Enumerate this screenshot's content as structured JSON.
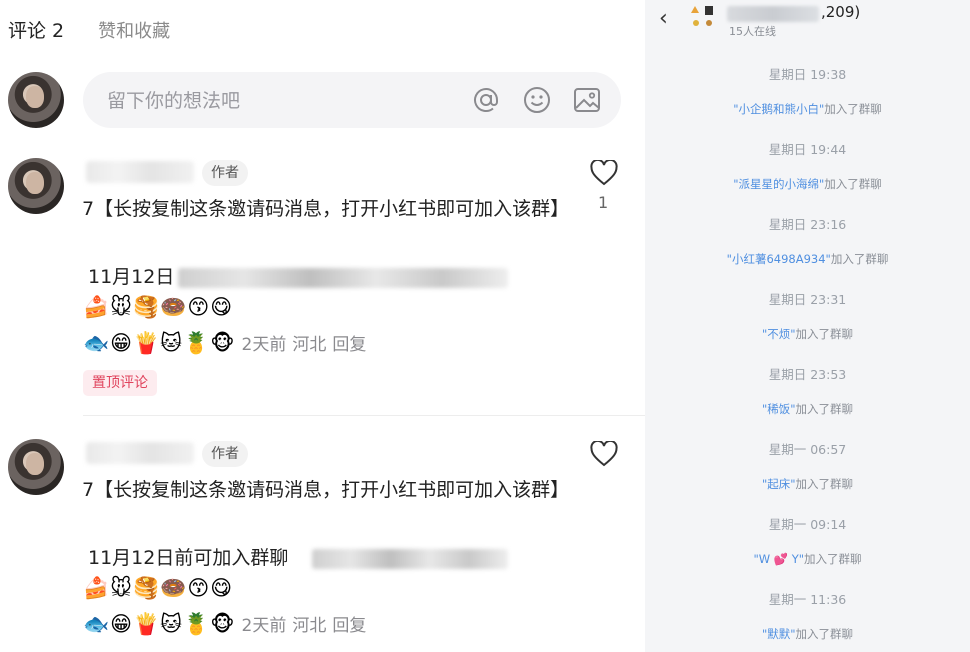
{
  "tabs": {
    "comments": "评论 2",
    "likes": "赞和收藏"
  },
  "input": {
    "placeholder": "留下你的想法吧",
    "icons": [
      "at-icon",
      "smiley-icon",
      "image-icon"
    ]
  },
  "comments": [
    {
      "author_tag": "作者",
      "text": "7【长按复制这条邀请码消息，打开小红书即可加入该群】",
      "line2": "11月12日",
      "emojis1": "🍰🐭🥞🍩😙😋",
      "emojis2": "🐟😁🍟🐱🍍🐵",
      "time": "2天前",
      "location": "河北",
      "reply": "回复",
      "likes": "1",
      "pin": "置顶评论"
    },
    {
      "author_tag": "作者",
      "text": "7【长按复制这条邀请码消息，打开小红书即可加入该群】",
      "line2": "11月12日前可加入群聊",
      "emojis1": "🍰🐭🥞🍩😙😋",
      "emojis2": "🐟😁🍟🐱🍍🐵",
      "time": "2天前",
      "location": "河北",
      "reply": "回复"
    }
  ],
  "chat": {
    "back": "‹",
    "member_count": ",209)",
    "online": "15人在线",
    "events": [
      {
        "time": "星期日 19:38",
        "name": "\"小企鹅和熊小白\"",
        "action": "加入了群聊"
      },
      {
        "time": "星期日 19:44",
        "name": "\"派星星的小海绵\"",
        "action": "加入了群聊"
      },
      {
        "time": "星期日 23:16",
        "name": "\"小红薯6498A934\"",
        "action": "加入了群聊"
      },
      {
        "time": "星期日 23:31",
        "name": "\"不烦\"",
        "action": "加入了群聊"
      },
      {
        "time": "星期日 23:53",
        "name": "\"稀饭\"",
        "action": "加入了群聊"
      },
      {
        "time": "星期一 06:57",
        "name": "\"起床\"",
        "action": "加入了群聊"
      },
      {
        "time": "星期一 09:14",
        "name": "\"W 💕 Y\"",
        "action": "加入了群聊"
      },
      {
        "time": "星期一 11:36",
        "name": "\"默默\"",
        "action": "加入了群聊"
      }
    ]
  },
  "colors": {
    "link_blue": "#4f8fe0",
    "pin_red": "#e0445d",
    "panel_bg": "#f4f5f7"
  }
}
